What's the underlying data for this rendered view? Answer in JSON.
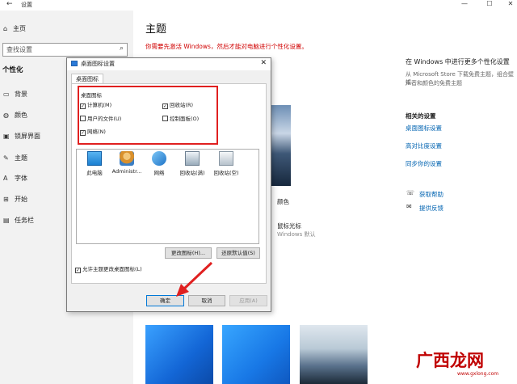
{
  "window": {
    "back_glyph": "←",
    "title": "设置",
    "controls": [
      "—",
      "☐",
      "✕"
    ]
  },
  "sidebar": {
    "home": "主页",
    "search_placeholder": "查找设置",
    "section": "个性化",
    "items": [
      {
        "label": "背景",
        "icon": "picture-icon",
        "glyph": "▭"
      },
      {
        "label": "颜色",
        "icon": "palette-icon",
        "glyph": "◍"
      },
      {
        "label": "锁屏界面",
        "icon": "lockscreen-icon",
        "glyph": "▣"
      },
      {
        "label": "主题",
        "icon": "theme-icon",
        "glyph": "✎"
      },
      {
        "label": "字体",
        "icon": "font-icon",
        "glyph": "A"
      },
      {
        "label": "开始",
        "icon": "start-icon",
        "glyph": "⊞"
      },
      {
        "label": "任务栏",
        "icon": "taskbar-icon",
        "glyph": "▤"
      }
    ]
  },
  "main": {
    "title": "主题",
    "warning": "你需要先激活 Windows，然后才能对电脑进行个性化设置。",
    "color_label": "颜色",
    "cursor_label": "鼠标光标",
    "cursor_value": "Windows 默认"
  },
  "right": {
    "store_heading": "在 Windows 中进行更多个性化设置",
    "store_desc_1": "从 Microsoft Store 下载免费主题，组合壁纸、",
    "store_desc_2": "声音和颜色的免费主题",
    "related_heading": "相关的设置",
    "links": [
      "桌面图标设置",
      "高对比度设置",
      "同步你的设置"
    ],
    "help_label": "获取帮助",
    "feedback_label": "提供反馈"
  },
  "dialog": {
    "title": "桌面图标设置",
    "close_glyph": "✕",
    "tab": "桌面图标",
    "group_label": "桌面图标",
    "checkboxes": {
      "computer": {
        "label": "计算机(M)",
        "checked": "✓"
      },
      "recycle": {
        "label": "回收站(R)",
        "checked": "✓"
      },
      "userfiles": {
        "label": "用户的文件(U)",
        "checked": ""
      },
      "controlpanel": {
        "label": "控制面板(O)",
        "checked": ""
      },
      "network": {
        "label": "网络(N)",
        "checked": "✓"
      }
    },
    "icons": [
      "此电脑",
      "Administr...",
      "网络",
      "回收站(满)",
      "回收站(空)"
    ],
    "change_icon_button": "更改图标(H)...",
    "restore_default_button": "还原默认值(S)",
    "allow_theme_label": "允许主题更改桌面图标(L)",
    "allow_theme_checked": "✓",
    "ok_button": "确定",
    "cancel_button": "取消",
    "apply_button": "应用(A)"
  },
  "watermark": {
    "text": "广西龙网",
    "sub": "www.gxlong.com"
  },
  "colors": {
    "accent": "#0063b1",
    "warning": "#d00000",
    "highlight_box": "#e02020"
  }
}
